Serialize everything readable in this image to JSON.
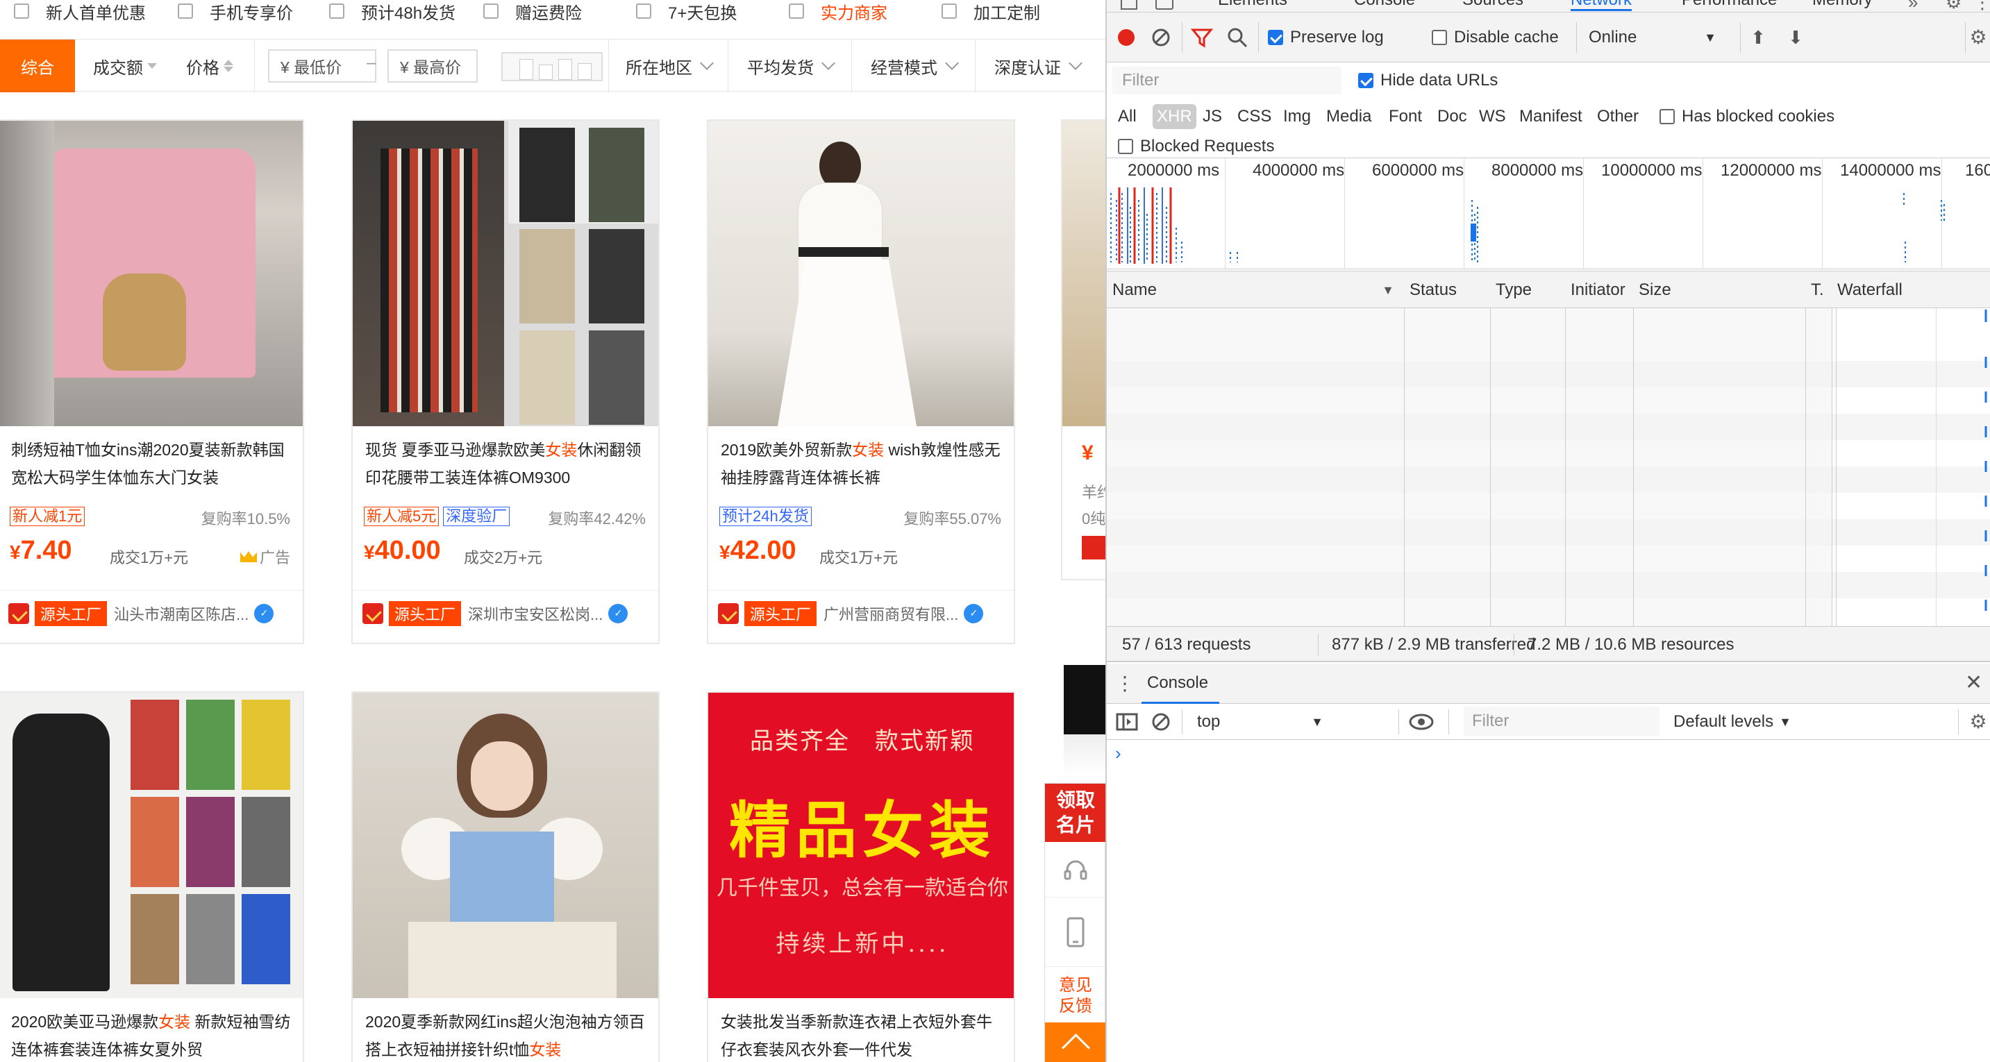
{
  "shop": {
    "filters": [
      {
        "label": "新人首单优惠"
      },
      {
        "label": "手机专享价"
      },
      {
        "label": "预计48h发货"
      },
      {
        "label": "赠运费险"
      },
      {
        "label": "7+天包换"
      },
      {
        "label": "实力商家"
      },
      {
        "label": "加工定制"
      }
    ],
    "sort": {
      "active": "综合",
      "volume": "成交额",
      "price": "价格",
      "min_price": "¥ 最低价",
      "dash": "–",
      "max_price": "¥ 最高价",
      "region": "所在地区",
      "shipping": "平均发货",
      "mode": "经营模式",
      "certified": "深度认证"
    },
    "products": [
      {
        "title_a": "刺绣短袖T恤女ins潮2020夏装新款韩国宽松大码学生体恤东大门女装",
        "title_hl": "",
        "title_b": "",
        "tags": [
          "新人减1元"
        ],
        "repurchase": "复购率10.5%",
        "currency": "¥",
        "price": "7.40",
        "deal": "成交1万+元",
        "ad": "广告",
        "badge": "源头工厂",
        "seller": "汕头市潮南区陈店..."
      },
      {
        "title_a": "现货 夏季亚马逊爆款欧美",
        "title_hl": "女装",
        "title_b": "休闲翻领印花腰带工装连体裤OM9300",
        "tags": [
          "新人减5元",
          "深度验厂"
        ],
        "repurchase": "复购率42.42%",
        "currency": "¥",
        "price": "40.00",
        "deal": "成交2万+元",
        "ad": "",
        "badge": "源头工厂",
        "seller": "深圳市宝安区松岗..."
      },
      {
        "title_a": "2019欧美外贸新款",
        "title_hl": "女装",
        "title_b": " wish敦煌性感无袖挂脖露背连体裤长裤",
        "tags": [
          "预计24h发货"
        ],
        "repurchase": "复购率55.07%",
        "currency": "¥",
        "price": "42.00",
        "deal": "成交1万+元",
        "ad": "",
        "badge": "源头工厂",
        "seller": "广州营丽商贸有限..."
      },
      {
        "title_a": "2020欧美亚马逊爆款",
        "title_hl": "女装",
        "title_b": " 新款短袖雪纺连体裤套装连体裤女夏外贸"
      },
      {
        "title_a": "2020夏季新款网红ins超火泡泡袖方领百搭上衣短袖拼接针织t恤",
        "title_hl": "女装",
        "title_b": ""
      },
      {
        "title_a": "女装批发当季新款连衣裙上衣短外套牛仔衣套装风衣外套一件代发",
        "title_hl": "",
        "title_b": ""
      }
    ],
    "partial_card": {
      "price_fragment": "¥",
      "line1": "羊约",
      "line2": "0纯"
    },
    "promo_image": {
      "line1": "品类齐全　款式新颖",
      "line2": "精品女装",
      "line3": "几千件宝贝，总会有一款适合你",
      "line4": "持续上新中...."
    },
    "side_panel": {
      "card": "领取名片",
      "feedback": "意见反馈"
    }
  },
  "devtools": {
    "tabs": [
      "Elements",
      "Console",
      "Sources",
      "Network",
      "Performance",
      "Memory"
    ],
    "active_tab": "Network",
    "toolbar": {
      "preserve_log": "Preserve log",
      "disable_cache": "Disable cache",
      "throttle": "Online"
    },
    "filter_placeholder": "Filter",
    "hide_data_urls": "Hide data URLs",
    "types": [
      "All",
      "XHR",
      "JS",
      "CSS",
      "Img",
      "Media",
      "Font",
      "Doc",
      "WS",
      "Manifest",
      "Other"
    ],
    "has_blocked_cookies": "Has blocked cookies",
    "blocked_requests": "Blocked Requests",
    "timeline_ticks": [
      "2000000 ms",
      "4000000 ms",
      "6000000 ms",
      "8000000 ms",
      "10000000 ms",
      "12000000 ms",
      "14000000 ms",
      "160"
    ],
    "columns": [
      "Name",
      "Status",
      "Type",
      "Initiator",
      "Size",
      "T.",
      "Waterfall"
    ],
    "summary": {
      "requests": "57 / 613 requests",
      "transferred": "877 kB / 2.9 MB transferred",
      "resources": "7.2 MB / 10.6 MB resources"
    },
    "drawer": {
      "title": "Console",
      "context": "top",
      "filter_placeholder": "Filter",
      "levels": "Default levels"
    },
    "prompt_symbol": "›",
    "colors": {
      "accent": "#1a73e8",
      "record": "#e1251b"
    }
  }
}
